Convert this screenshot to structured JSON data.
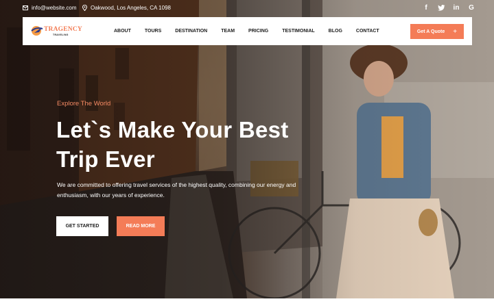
{
  "topbar": {
    "email": "info@website.com",
    "address": "Oakwood, Los Angeles, CA 1098",
    "socials": [
      {
        "icon": "facebook-icon",
        "glyph": "f"
      },
      {
        "icon": "twitter-icon",
        "glyph": "t"
      },
      {
        "icon": "linkedin-icon",
        "glyph": "in"
      },
      {
        "icon": "google-icon",
        "glyph": "G"
      }
    ]
  },
  "nav": {
    "logo_text": "TRAGENCY",
    "logo_sub": "TRAVELING",
    "items": [
      "ABOUT",
      "TOURS",
      "DESTINATION",
      "TEAM",
      "PRICING",
      "TESTIMONIAL",
      "BLOG",
      "CONTACT"
    ],
    "quote_label": "Get A Quote",
    "quote_icon": "+"
  },
  "hero": {
    "tagline": "Explore The World",
    "headline_line1": "Let`s Make Your Best",
    "headline_line2": "Trip Ever",
    "description": "We are committed to offering travel services of the highest quality, combining our energy and enthusiasm, with our years of experience.",
    "primary_button": "GET STARTED",
    "secondary_button": "READ MORE"
  },
  "colors": {
    "accent": "#f47c57",
    "text_dark": "#1c1c1c",
    "white": "#ffffff"
  }
}
